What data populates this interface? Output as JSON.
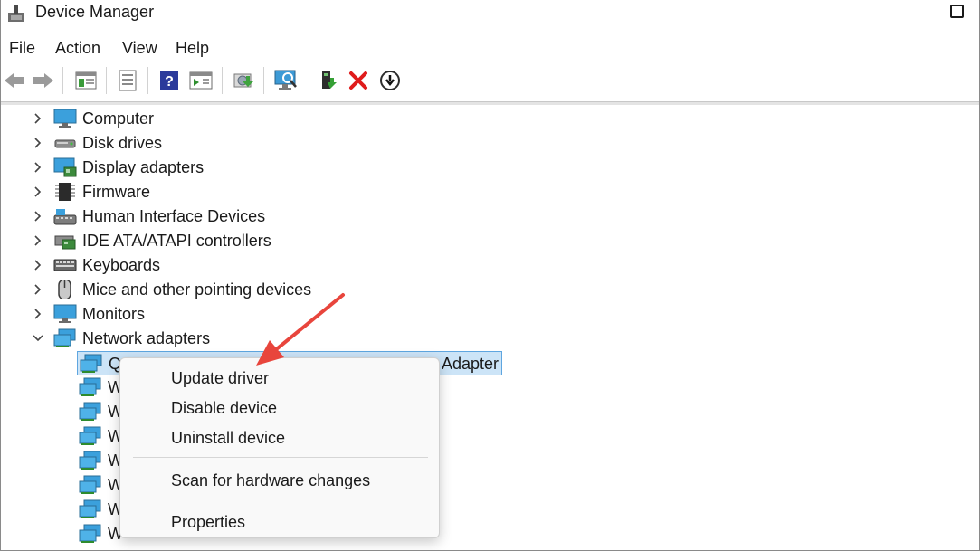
{
  "window": {
    "title": "Device Manager"
  },
  "menu": [
    "File",
    "Action",
    "View",
    "Help"
  ],
  "toolbar": {
    "buttons": [
      "back-icon",
      "forward-icon",
      "show-hide-console-tree-icon",
      "properties-icon",
      "help-icon",
      "action-pane-icon",
      "update-driver-icon",
      "scan-hardware-icon",
      "enable-device-icon",
      "uninstall-icon",
      "disable-device-icon"
    ]
  },
  "tree": {
    "categories": [
      {
        "label": "Computer",
        "expanded": false
      },
      {
        "label": "Disk drives",
        "expanded": false
      },
      {
        "label": "Display adapters",
        "expanded": false
      },
      {
        "label": "Firmware",
        "expanded": false
      },
      {
        "label": "Human Interface Devices",
        "expanded": false
      },
      {
        "label": "IDE ATA/ATAPI controllers",
        "expanded": false
      },
      {
        "label": "Keyboards",
        "expanded": false
      },
      {
        "label": "Mice and other pointing devices",
        "expanded": false
      },
      {
        "label": "Monitors",
        "expanded": false
      },
      {
        "label": "Network adapters",
        "expanded": true
      }
    ],
    "network_children": [
      {
        "label": "Q",
        "label_end": "Adapter",
        "selected": true
      },
      {
        "label": "W"
      },
      {
        "label": "W"
      },
      {
        "label": "W"
      },
      {
        "label": "W"
      },
      {
        "label": "W"
      },
      {
        "label": "W"
      },
      {
        "label": "W"
      }
    ]
  },
  "context_menu": {
    "items": [
      "Update driver",
      "Disable device",
      "Uninstall device",
      "Scan for hardware changes",
      "Properties"
    ]
  },
  "colors": {
    "selection_bg": "#cce4f7",
    "annotation_arrow": "#e8453c",
    "uninstall_x": "#e01b1b"
  }
}
